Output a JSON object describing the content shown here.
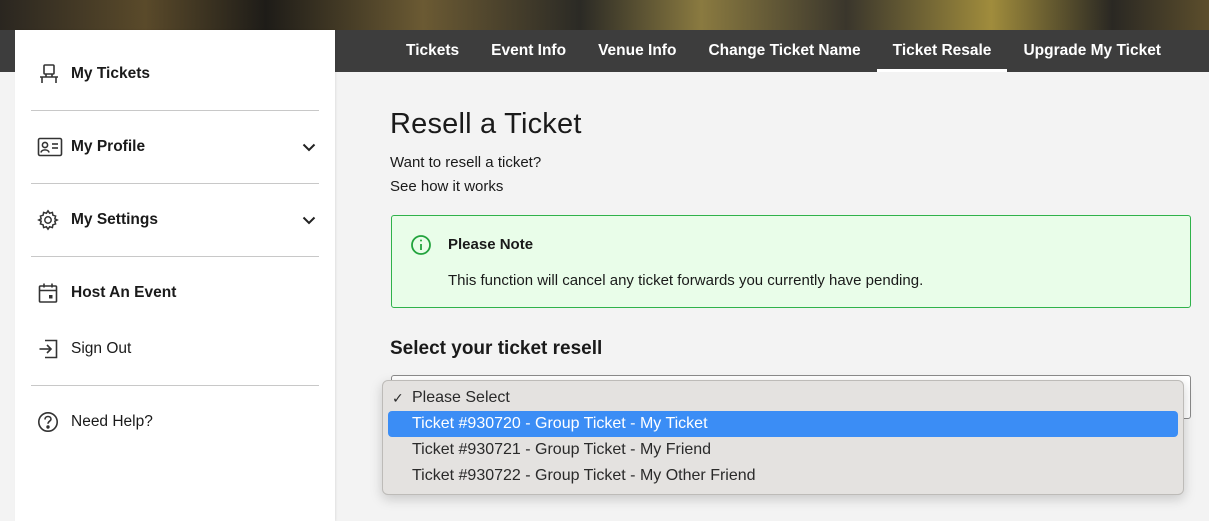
{
  "nav": {
    "tabs": [
      {
        "label": "Tickets"
      },
      {
        "label": "Event Info"
      },
      {
        "label": "Venue Info"
      },
      {
        "label": "Change Ticket Name"
      },
      {
        "label": "Ticket Resale"
      },
      {
        "label": "Upgrade My Ticket"
      }
    ],
    "active_tab": "Ticket Resale"
  },
  "sidebar": {
    "items": [
      {
        "label": "My Tickets",
        "icon": "seat-icon"
      },
      {
        "label": "My Profile",
        "icon": "id-card-icon"
      },
      {
        "label": "My Settings",
        "icon": "gear-icon"
      },
      {
        "label": "Host An Event",
        "icon": "calendar-icon"
      },
      {
        "label": "Sign Out",
        "icon": "sign-out-icon"
      },
      {
        "label": "Need Help?",
        "icon": "help-icon"
      }
    ]
  },
  "main": {
    "title": "Resell a Ticket",
    "intro": "Want to resell a ticket?",
    "how_link": "See how it works",
    "note": {
      "heading": "Please Note",
      "body": "This function will cancel any ticket forwards you currently have pending."
    },
    "select_label": "Select your ticket resell",
    "select": {
      "options": [
        {
          "label": "Please Select",
          "checked": true
        },
        {
          "label": "Ticket #930720 - Group Ticket - My Ticket",
          "highlighted": true
        },
        {
          "label": "Ticket #930721 - Group Ticket - My Friend"
        },
        {
          "label": "Ticket #930722 - Group Ticket - My Other Friend"
        }
      ],
      "check_glyph": "✓"
    }
  },
  "colors": {
    "navbar": "#3d3d3d",
    "note_bg": "#e9fde9",
    "note_border": "#2fb24a",
    "highlight": "#3b8df5"
  }
}
